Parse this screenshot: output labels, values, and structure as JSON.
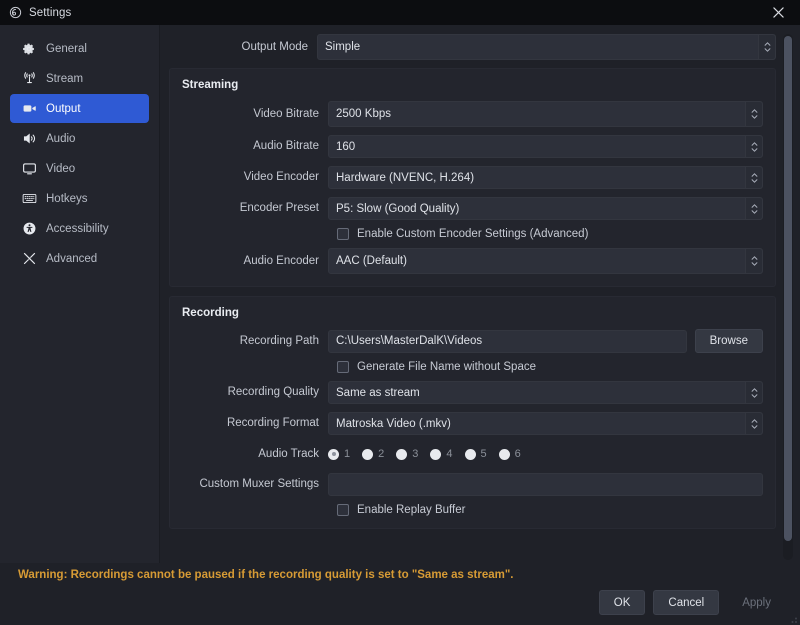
{
  "window": {
    "title": "Settings",
    "app_icon": "obs-logo-icon",
    "close_label": "✕"
  },
  "sidebar": {
    "items": [
      {
        "label": "General",
        "icon": "gear-icon",
        "active": false
      },
      {
        "label": "Stream",
        "icon": "broadcast-icon",
        "active": false
      },
      {
        "label": "Output",
        "icon": "video-camera-icon",
        "active": true
      },
      {
        "label": "Audio",
        "icon": "speaker-icon",
        "active": false
      },
      {
        "label": "Video",
        "icon": "monitor-icon",
        "active": false
      },
      {
        "label": "Hotkeys",
        "icon": "keyboard-icon",
        "active": false
      },
      {
        "label": "Accessibility",
        "icon": "accessibility-icon",
        "active": false
      },
      {
        "label": "Advanced",
        "icon": "tools-icon",
        "active": false
      }
    ]
  },
  "output_mode": {
    "label": "Output Mode",
    "value": "Simple"
  },
  "streaming": {
    "title": "Streaming",
    "video_bitrate": {
      "label": "Video Bitrate",
      "value": "2500 Kbps"
    },
    "audio_bitrate": {
      "label": "Audio Bitrate",
      "value": "160"
    },
    "video_encoder": {
      "label": "Video Encoder",
      "value": "Hardware (NVENC, H.264)"
    },
    "encoder_preset": {
      "label": "Encoder Preset",
      "value": "P5: Slow (Good Quality)"
    },
    "custom_encoder": {
      "label": "Enable Custom Encoder Settings (Advanced)",
      "checked": false
    },
    "audio_encoder": {
      "label": "Audio Encoder",
      "value": "AAC (Default)"
    }
  },
  "recording": {
    "title": "Recording",
    "path": {
      "label": "Recording Path",
      "value": "C:\\Users\\MasterDalK\\Videos"
    },
    "browse_label": "Browse",
    "no_space": {
      "label": "Generate File Name without Space",
      "checked": false
    },
    "quality": {
      "label": "Recording Quality",
      "value": "Same as stream"
    },
    "format": {
      "label": "Recording Format",
      "value": "Matroska Video (.mkv)"
    },
    "audio_track": {
      "label": "Audio Track",
      "options": [
        "1",
        "2",
        "3",
        "4",
        "5",
        "6"
      ],
      "selected": "1"
    },
    "muxer": {
      "label": "Custom Muxer Settings",
      "value": "",
      "placeholder": ""
    },
    "replay_buffer": {
      "label": "Enable Replay Buffer",
      "checked": false
    }
  },
  "footer": {
    "warning": "Warning: Recordings cannot be paused if the recording quality is set to \"Same as stream\".",
    "ok_label": "OK",
    "cancel_label": "Cancel",
    "apply_label": "Apply",
    "apply_enabled": false
  },
  "colors": {
    "accent": "#2f5ad4",
    "warning": "#d79b35",
    "panel": "#23252d",
    "background": "#1f2128",
    "field": "#2d303a"
  }
}
